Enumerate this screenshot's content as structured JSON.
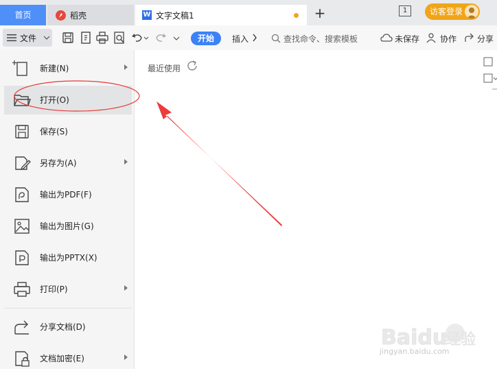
{
  "tabs": {
    "home": "首页",
    "daoke": "稻壳",
    "doc": "文字文稿1"
  },
  "header": {
    "page_indicator": "1",
    "login": "访客登录"
  },
  "toolbar": {
    "file": "文件",
    "start": "开始",
    "insert": "插入",
    "search_placeholder": "查找命令、搜索模板",
    "unsaved": "未保存",
    "collaborate": "协作",
    "share": "分享"
  },
  "menu": {
    "items": [
      {
        "label": "新建(N)",
        "icon": "new-document-icon",
        "submenu": true
      },
      {
        "label": "打开(O)",
        "icon": "open-folder-icon",
        "submenu": false,
        "active": true
      },
      {
        "label": "保存(S)",
        "icon": "save-icon",
        "submenu": false
      },
      {
        "label": "另存为(A)",
        "icon": "save-as-icon",
        "submenu": true
      },
      {
        "label": "输出为PDF(F)",
        "icon": "export-pdf-icon",
        "submenu": false
      },
      {
        "label": "输出为图片(G)",
        "icon": "export-image-icon",
        "submenu": false
      },
      {
        "label": "输出为PPTX(X)",
        "icon": "export-pptx-icon",
        "submenu": false
      },
      {
        "label": "打印(P)",
        "icon": "print-icon",
        "submenu": true
      },
      {
        "label": "分享文档(D)",
        "icon": "share-document-icon",
        "submenu": false
      },
      {
        "label": "文档加密(E)",
        "icon": "encrypt-document-icon",
        "submenu": true
      }
    ]
  },
  "recent": {
    "title": "最近使用"
  },
  "annotation": {
    "highlight_color": "#e53935",
    "arrow_color": "#ee3b3b"
  },
  "watermark": {
    "brand": "Baidu",
    "brand_cn": "经验",
    "url": "jingyan.baidu.com"
  },
  "colors": {
    "accent": "#3c82f6",
    "login": "#f0a519",
    "home_tab": "#4f8ff8"
  }
}
